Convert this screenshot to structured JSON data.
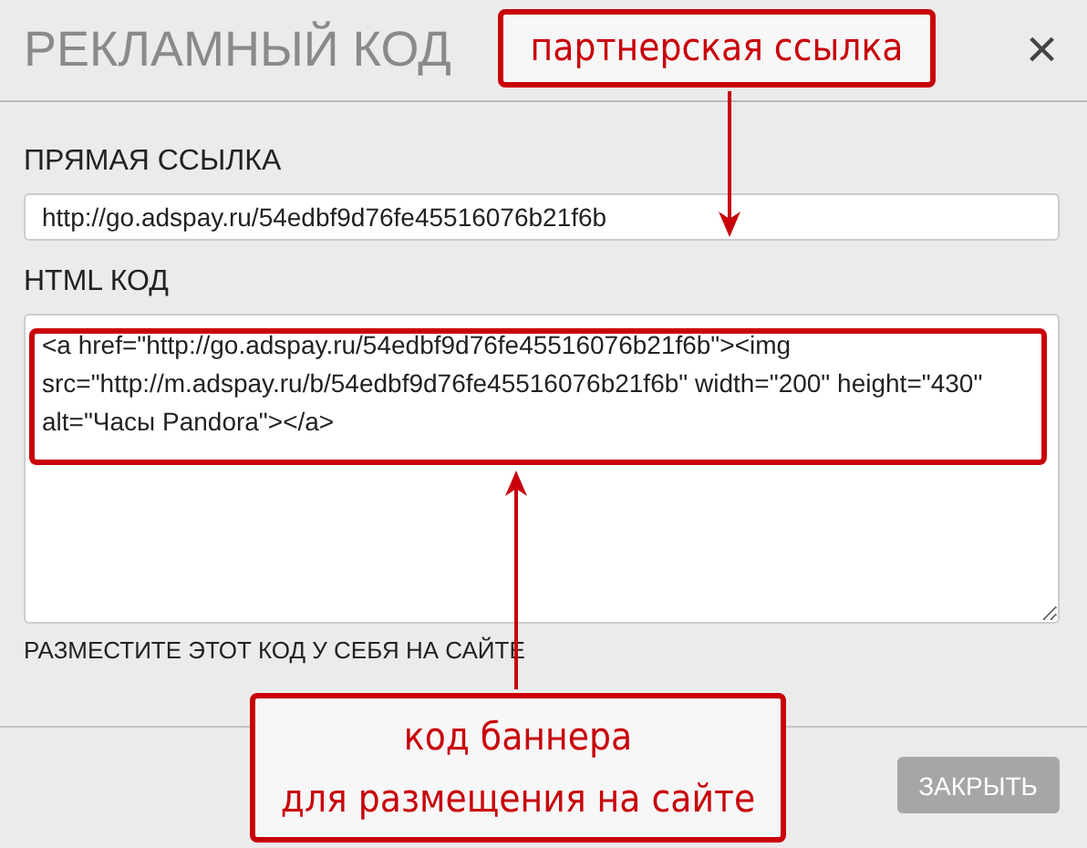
{
  "dialog": {
    "title": "РЕКЛАМНЫЙ КОД",
    "close_icon": "×"
  },
  "direct_link": {
    "label": "ПРЯМАЯ ССЫЛКА",
    "value": "http://go.adspay.ru/54edbf9d76fe45516076b21f6b"
  },
  "html_code": {
    "label": "HTML КОД",
    "value": "<a href=\"http://go.adspay.ru/54edbf9d76fe45516076b21f6b\"><img src=\"http://m.adspay.ru/b/54edbf9d76fe45516076b21f6b\" width=\"200\" height=\"430\" alt=\"Часы Pandora\"></a>",
    "note": "РАЗМЕСТИТЕ ЭТОТ КОД У СЕБЯ НА САЙТЕ"
  },
  "buttons": [
    {
      "label": "ЗАКРЫТЬ",
      "disabled": true
    }
  ],
  "annotations": [
    {
      "kind": "top",
      "text": "партнерская ссылка"
    },
    {
      "kind": "bottom",
      "lines": [
        "код баннера",
        "для размещения на сайте"
      ]
    }
  ]
}
